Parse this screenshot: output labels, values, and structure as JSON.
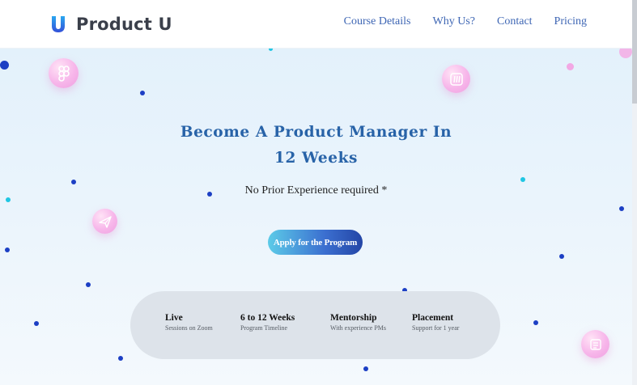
{
  "header": {
    "logo_letter": "U",
    "brand_name": "Product U",
    "nav_items": [
      {
        "label": "Course Details"
      },
      {
        "label": "Why Us?"
      },
      {
        "label": "Contact"
      },
      {
        "label": "Pricing"
      }
    ]
  },
  "hero": {
    "headline_line1": "Become A Product Manager In",
    "headline_line2": "12 Weeks",
    "subheadline": "No Prior Experience required *",
    "cta_label": "Apply for the Program",
    "floating_icons": [
      "figma-icon",
      "miro-icon",
      "airplane-icon",
      "notebook-icon"
    ]
  },
  "features": [
    {
      "title": "Live",
      "description": "Sessions on Zoom"
    },
    {
      "title": "6 to 12 Weeks",
      "description": "Program Timeline"
    },
    {
      "title": "Mentorship",
      "description": "With experience PMs"
    },
    {
      "title": "Placement",
      "description": "Support for 1 year"
    }
  ],
  "colors": {
    "brand_text": "#3a3f4a",
    "nav_link": "#3e66b4",
    "headline": "#2863a8",
    "cta_gradient_start": "#5ccbe8",
    "cta_gradient_end": "#2446a6",
    "dot_blue": "#1c3fc4",
    "dot_cyan": "#1fc6e3",
    "bubble_pink": "#f7b6ea",
    "feature_panel": "#dde3ea"
  }
}
